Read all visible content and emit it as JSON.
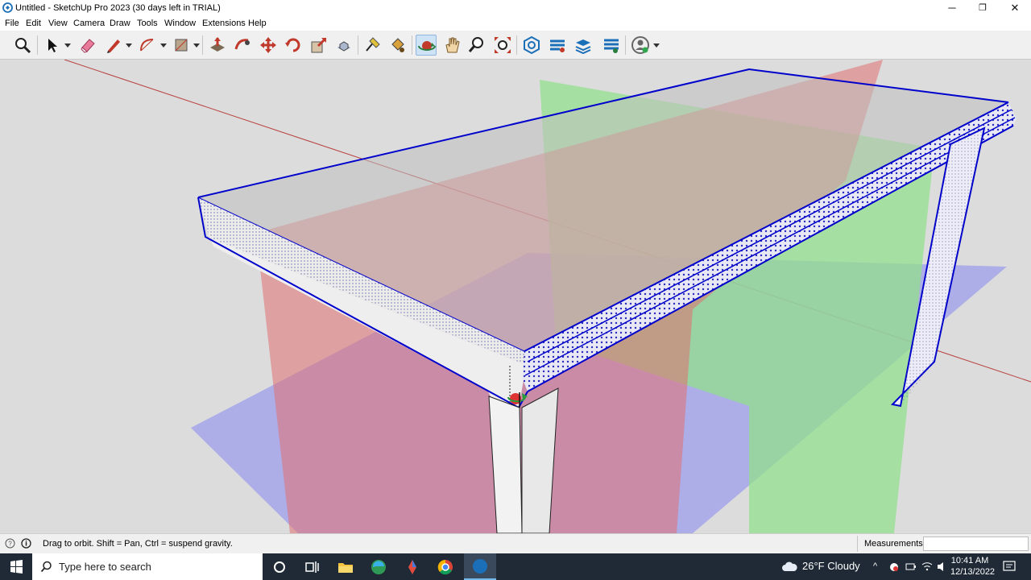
{
  "window": {
    "title": "Untitled - SketchUp Pro 2023 (30 days left in TRIAL)",
    "minimize": "─",
    "restore": "❐",
    "close": "✕"
  },
  "menu": [
    "File",
    "Edit",
    "View",
    "Camera",
    "Draw",
    "Tools",
    "Window",
    "Extensions",
    "Help"
  ],
  "toolbar": {
    "tools": [
      {
        "name": "zoom-tool-icon"
      },
      {
        "name": "select-tool-icon"
      },
      {
        "name": "eraser-tool-icon"
      },
      {
        "name": "pencil-line-tool-icon"
      },
      {
        "name": "arc-tool-icon"
      },
      {
        "name": "rectangle-tool-icon"
      },
      {
        "name": "push-pull-tool-icon"
      },
      {
        "name": "follow-me-tool-icon"
      },
      {
        "name": "move-tool-icon"
      },
      {
        "name": "rotate-tool-icon"
      },
      {
        "name": "scale-tool-icon"
      },
      {
        "name": "offset-tool-icon"
      },
      {
        "name": "tape-measure-tool-icon"
      },
      {
        "name": "paint-bucket-tool-icon"
      },
      {
        "name": "orbit-tool-icon",
        "active": true
      },
      {
        "name": "pan-tool-icon"
      },
      {
        "name": "zoom-window-tool-icon"
      },
      {
        "name": "zoom-extents-tool-icon"
      },
      {
        "name": "warehouse-icon"
      },
      {
        "name": "extension-warehouse-icon"
      },
      {
        "name": "layout-icon"
      },
      {
        "name": "sandbox-icon"
      },
      {
        "name": "profile-icon"
      }
    ]
  },
  "status": {
    "hint": "Drag to orbit. Shift = Pan, Ctrl = suspend gravity.",
    "measurements_label": "Measurements",
    "measurements_value": ""
  },
  "taskbar": {
    "search_placeholder": "Type here to search",
    "weather": "26°F  Cloudy",
    "time": "10:41 AM",
    "date": "12/13/2022"
  },
  "colors": {
    "axis_red": "#cc3b3b",
    "axis_green": "#7fd07f",
    "axis_blue": "#6f6fe0",
    "selection_blue": "#0000cc",
    "sky": "#dcdcdc"
  }
}
